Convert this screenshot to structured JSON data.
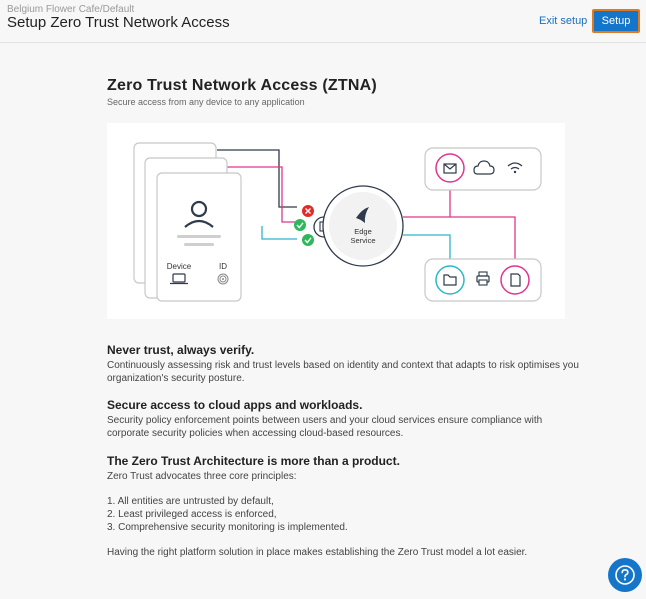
{
  "header": {
    "breadcrumb": "Belgium Flower Cafe/Default",
    "title": "Setup Zero Trust Network Access",
    "exit_label": "Exit setup",
    "setup_label": "Setup"
  },
  "intro": {
    "title": "Zero Trust Network Access (ZTNA)",
    "subtitle": "Secure access from any device to any application"
  },
  "diagram": {
    "device_label": "Device",
    "id_label": "ID",
    "edge_line1": "Edge",
    "edge_line2": "Service",
    "icons": [
      "mail-icon",
      "cloud-icon",
      "wifi-icon",
      "folder-icon",
      "printer-icon",
      "sd-card-icon"
    ],
    "colors": {
      "magenta": "#e0358f",
      "teal": "#2bb7c9",
      "green": "#2eb85c",
      "red": "#e02b2b",
      "dark": "#2f3a4a"
    }
  },
  "sections": [
    {
      "heading": "Never trust, always verify.",
      "body": "Continuously assessing risk and trust levels based on identity and context that adapts to risk optimises you organization's security posture."
    },
    {
      "heading": "Secure access to cloud apps and workloads.",
      "body": "Security policy enforcement points between users and your cloud services ensure compliance with corporate security policies when accessing cloud-based resources."
    },
    {
      "heading": "The Zero Trust Architecture is more than a product.",
      "body": "Zero Trust advocates three core principles:"
    }
  ],
  "principles": [
    "1. All entities are untrusted by default,",
    "2. Least privileged access is enforced,",
    "3. Comprehensive security monitoring is implemented."
  ],
  "closing": "Having the right platform solution in place makes establishing the Zero Trust model a lot easier.",
  "help": {
    "icon": "question-icon"
  }
}
